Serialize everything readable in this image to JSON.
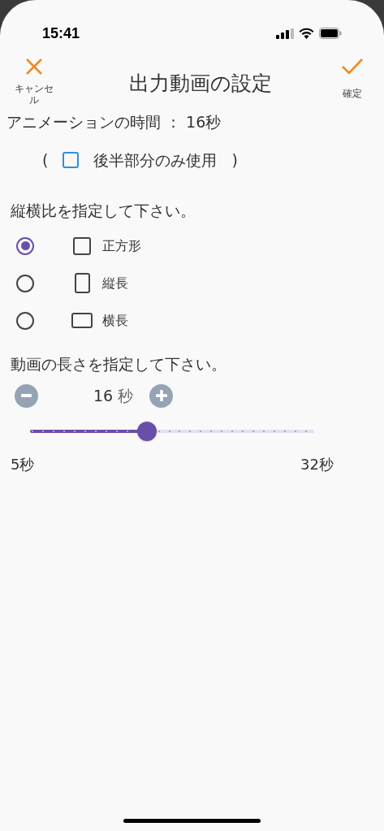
{
  "status_bar": {
    "time": "15:41"
  },
  "header": {
    "cancel": "キャンセル",
    "title": "出力動画の設定",
    "confirm": "確定"
  },
  "animation_time": "アニメーションの時間 ： 16秒",
  "second_half": {
    "open": "(",
    "label": "後半部分のみ使用",
    "close": ")",
    "checked": false
  },
  "aspect": {
    "prompt": "縦横比を指定して下さい。",
    "options": [
      {
        "kind": "square",
        "label": "正方形",
        "selected": true
      },
      {
        "kind": "portrait",
        "label": "縦長",
        "selected": false
      },
      {
        "kind": "landscape",
        "label": "横長",
        "selected": false
      }
    ]
  },
  "length": {
    "prompt": "動画の長さを指定して下さい。",
    "value": "16",
    "unit": "秒",
    "level": 0.41,
    "min_label": "5秒",
    "max_label": "32秒"
  }
}
